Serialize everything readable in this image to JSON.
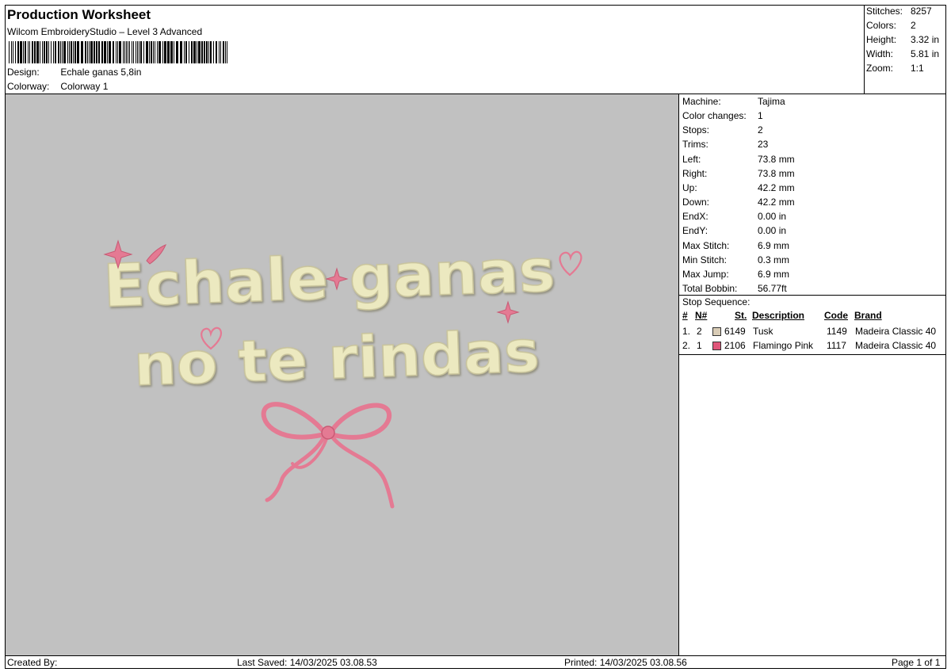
{
  "header": {
    "title": "Production Worksheet",
    "subtitle": "Wilcom EmbroideryStudio – Level 3 Advanced",
    "design_label": "Design:",
    "design_value": "Echale ganas 5,8in",
    "colorway_label": "Colorway:",
    "colorway_value": "Colorway 1"
  },
  "stats": [
    {
      "label": "Stitches:",
      "value": "8257"
    },
    {
      "label": "Colors:",
      "value": "2"
    },
    {
      "label": "Height:",
      "value": "3.32 in"
    },
    {
      "label": "Width:",
      "value": "5.81 in"
    },
    {
      "label": "Zoom:",
      "value": "1:1"
    }
  ],
  "machine": [
    {
      "label": "Machine:",
      "value": "Tajima"
    },
    {
      "label": "Color changes:",
      "value": "1"
    },
    {
      "label": "Stops:",
      "value": "2"
    },
    {
      "label": "Trims:",
      "value": "23"
    },
    {
      "label": "Left:",
      "value": "73.8 mm"
    },
    {
      "label": "Right:",
      "value": "73.8 mm"
    },
    {
      "label": "Up:",
      "value": "42.2 mm"
    },
    {
      "label": "Down:",
      "value": "42.2 mm"
    },
    {
      "label": "EndX:",
      "value": "0.00 in"
    },
    {
      "label": "EndY:",
      "value": "0.00 in"
    },
    {
      "label": "Max Stitch:",
      "value": "6.9 mm"
    },
    {
      "label": "Min Stitch:",
      "value": "0.3 mm"
    },
    {
      "label": "Max Jump:",
      "value": "6.9 mm"
    },
    {
      "label": "Total Bobbin:",
      "value": "56.77ft"
    }
  ],
  "stop_sequence": {
    "title": "Stop Sequence:",
    "headers": {
      "hash": "#",
      "n": "N#",
      "st": "St.",
      "description": "Description",
      "code": "Code",
      "brand": "Brand"
    },
    "rows": [
      {
        "index": "1.",
        "n": "2",
        "color": "#d9ccb6",
        "st": "6149",
        "description": "Tusk",
        "code": "1149",
        "brand": "Madeira Classic 40"
      },
      {
        "index": "2.",
        "n": "1",
        "color": "#e0567a",
        "st": "2106",
        "description": "Flamingo Pink",
        "code": "1117",
        "brand": "Madeira Classic 40"
      }
    ]
  },
  "design_text": {
    "line1": "Echale ganas",
    "line2": "no te rindas"
  },
  "colors": {
    "thread_cream": "#ece9c0",
    "thread_cream_shadow": "#b9b48c",
    "thread_pink": "#e47a93",
    "thread_pink_dark": "#c85a74",
    "preview_bg": "#c1c1c1"
  },
  "footer": {
    "created_by": "Created By:",
    "last_saved": "Last Saved: 14/03/2025 03.08.53",
    "printed": "Printed: 14/03/2025 03.08.56",
    "page": "Page 1 of 1"
  }
}
